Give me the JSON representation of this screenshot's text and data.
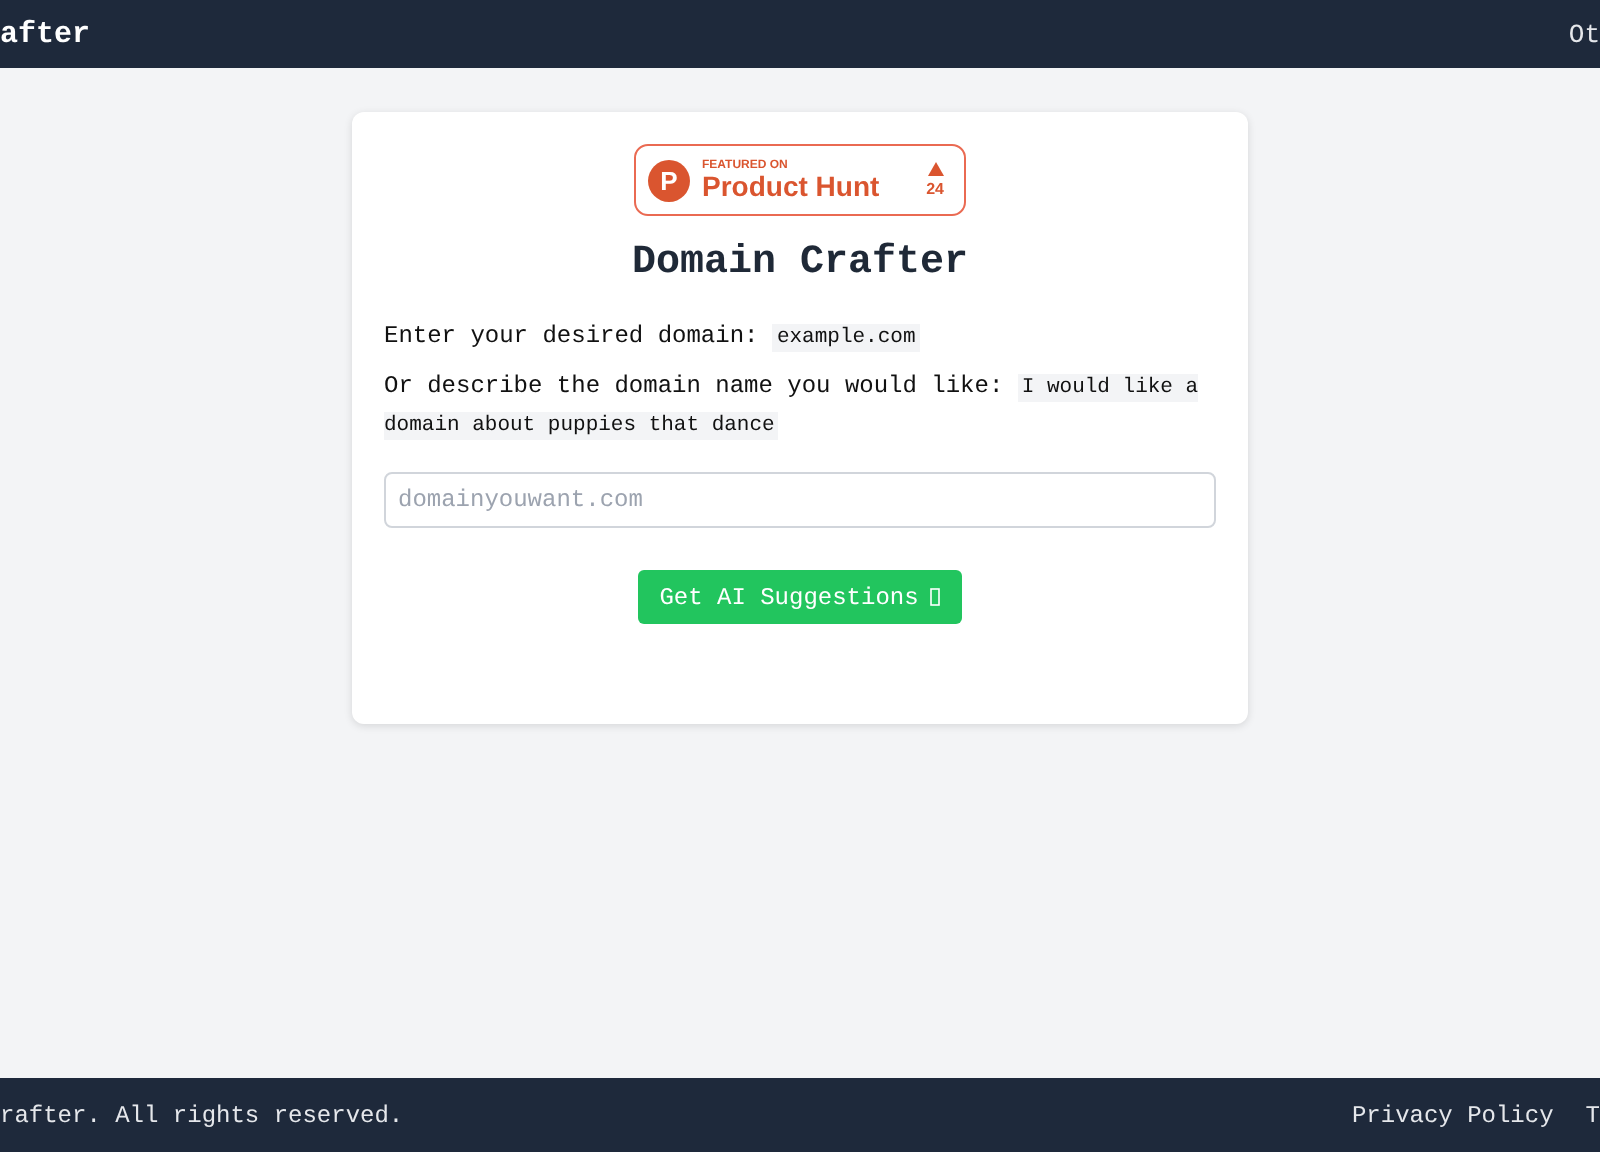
{
  "header": {
    "brand": "after",
    "nav_link": "Ot"
  },
  "badge": {
    "logo_letter": "P",
    "caption": "FEATURED ON",
    "name": "Product Hunt",
    "votes": "24"
  },
  "title": "Domain Crafter",
  "instructions": [
    {
      "label": "Enter your desired domain:",
      "example": "example.com"
    },
    {
      "label": "Or describe the domain name you would like:",
      "example": "I would like a domain about puppies that dance"
    }
  ],
  "domain_field": {
    "placeholder": "domainyouwant.com"
  },
  "submit_button": {
    "label": "Get AI Suggestions"
  },
  "footer": {
    "copyright": "rafter. All rights reserved.",
    "links": [
      "Privacy Policy",
      "T"
    ]
  }
}
